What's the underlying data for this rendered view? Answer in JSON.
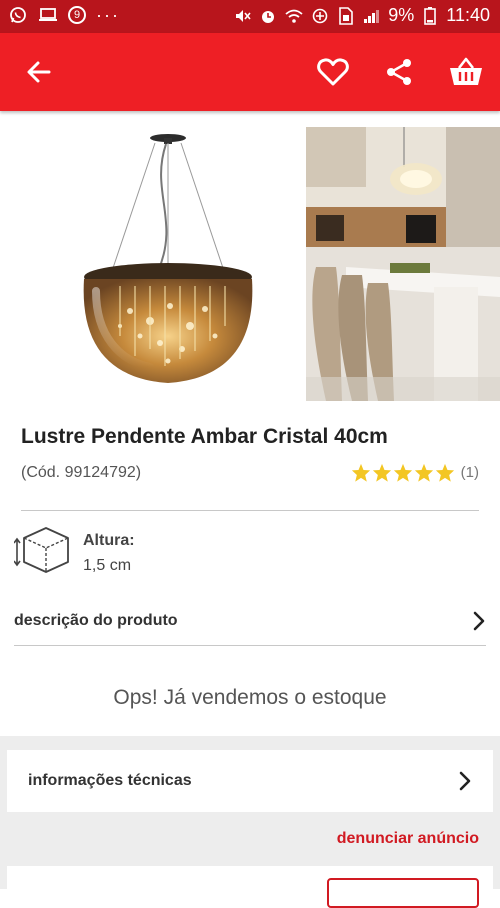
{
  "status_bar": {
    "notification_count": "9",
    "battery_percent": "9%",
    "time": "11:40",
    "more": "···"
  },
  "product": {
    "title": "Lustre Pendente Ambar Cristal 40cm",
    "code": "(Cód. 99124792)",
    "rating_stars": 5,
    "rating_count": "(1)",
    "dimension_label": "Altura:",
    "dimension_value": "1,5 cm"
  },
  "sections": {
    "description": "descrição do produto",
    "sold_out": "Ops! Já vendemos o estoque",
    "technical_info": "informações técnicas",
    "report": "denunciar anúncio"
  },
  "colors": {
    "status_bar": "#b8151c",
    "app_bar": "#ee1f25",
    "accent": "#d11a22",
    "star": "#f3c623"
  },
  "icons": [
    "back-arrow-icon",
    "heart-icon",
    "share-icon",
    "basket-icon",
    "chevron-right-icon",
    "dimension-box-icon",
    "star-icon"
  ]
}
